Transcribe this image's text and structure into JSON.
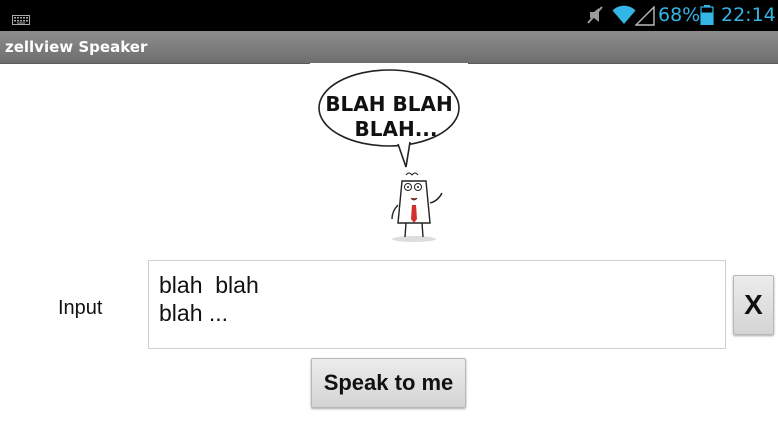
{
  "status_bar": {
    "battery_percent": "68%",
    "time": "22:14",
    "accent_color": "#33b5e5",
    "icons": [
      "keyboard-icon",
      "mute-icon",
      "wifi-icon",
      "signal-icon",
      "battery-icon"
    ]
  },
  "app": {
    "title": "zellview Speaker"
  },
  "illustration": {
    "speech_text_line1": "BLAH BLAH",
    "speech_text_line2": "BLAH..."
  },
  "form": {
    "input_label": "Input",
    "input_value": "blah  blah\nblah ...",
    "clear_label": "X",
    "speak_label": "Speak to me"
  }
}
